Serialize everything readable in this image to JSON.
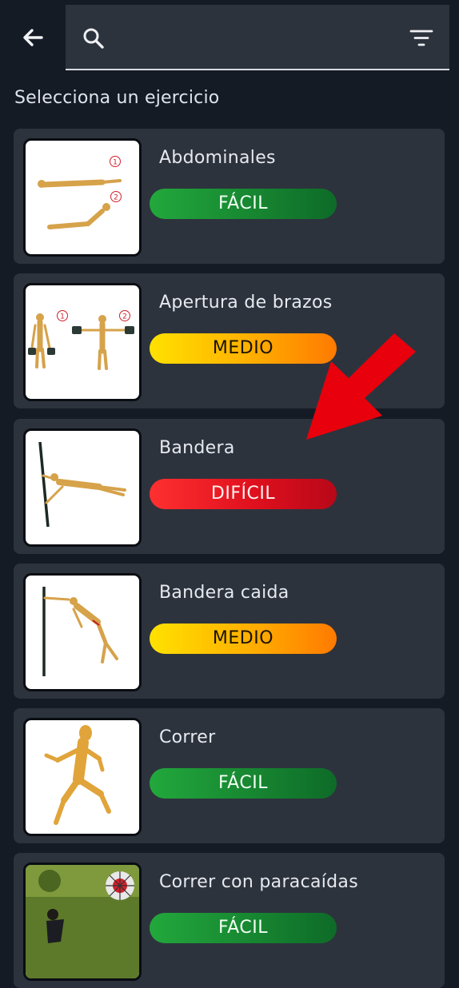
{
  "search": {
    "placeholder": ""
  },
  "heading": "Selecciona un ejercicio",
  "icons": {
    "back": "arrow-left-icon",
    "search": "search-icon",
    "filter": "filter-icon"
  },
  "colors": {
    "background": "#151b25",
    "card": "#2d333d",
    "easy": "#1f9a38",
    "medium": "#ffc400",
    "hard": "#e8141f",
    "annotation_arrow": "#e8000c"
  },
  "exercises": [
    {
      "name": "Abdominales",
      "difficulty": "FÁCIL"
    },
    {
      "name": "Apertura de brazos",
      "difficulty": "MEDIO"
    },
    {
      "name": "Bandera",
      "difficulty": "DIFÍCIL"
    },
    {
      "name": "Bandera caida",
      "difficulty": "MEDIO"
    },
    {
      "name": "Correr",
      "difficulty": "FÁCIL"
    },
    {
      "name": "Correr con paracaídas",
      "difficulty": "FÁCIL"
    }
  ],
  "thumb_labels": {
    "step1": "1",
    "step2": "2"
  }
}
